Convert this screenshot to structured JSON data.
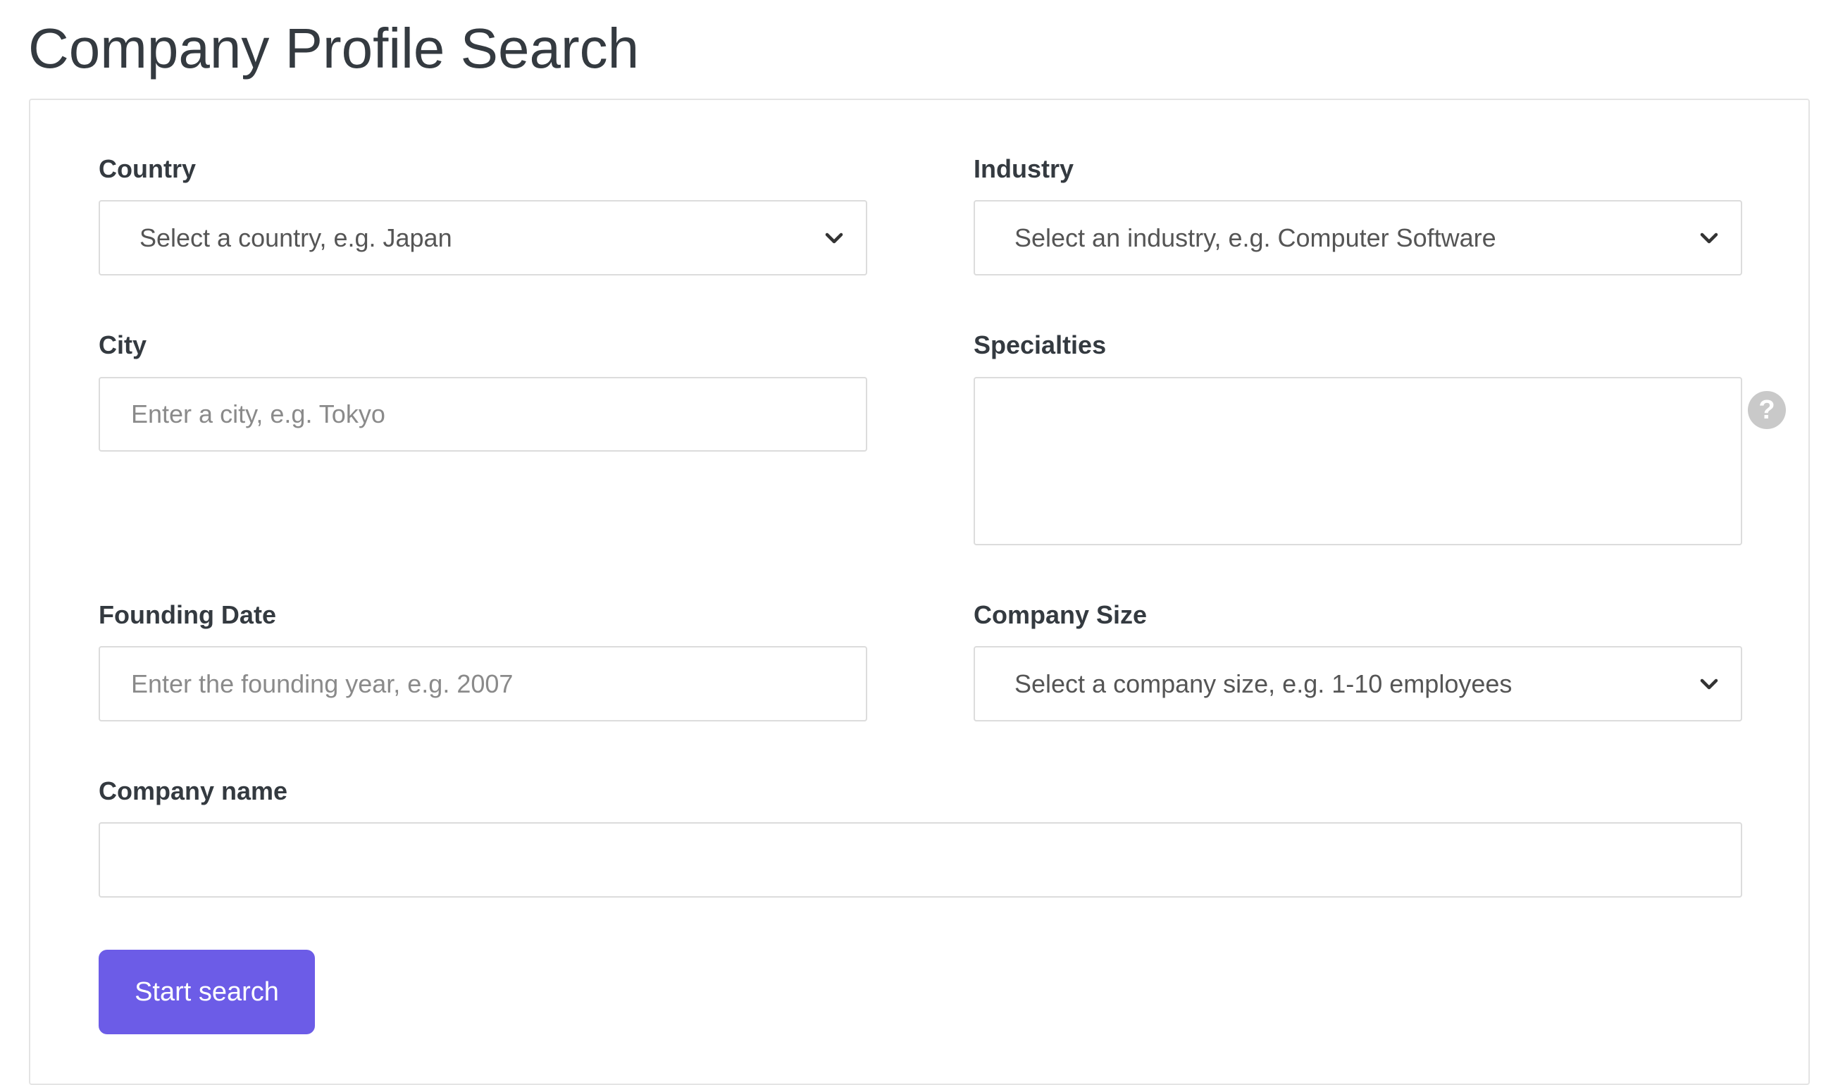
{
  "page": {
    "title": "Company Profile Search"
  },
  "form": {
    "country": {
      "label": "Country",
      "selected": "Select a country, e.g. Japan"
    },
    "industry": {
      "label": "Industry",
      "selected": "Select an industry, e.g. Computer Software"
    },
    "city": {
      "label": "City",
      "value": "",
      "placeholder": "Enter a city, e.g. Tokyo"
    },
    "specialties": {
      "label": "Specialties",
      "value": "",
      "help_icon": "question-circle-icon",
      "help_glyph": "?"
    },
    "founding_date": {
      "label": "Founding Date",
      "value": "",
      "placeholder": "Enter the founding year, e.g. 2007"
    },
    "company_size": {
      "label": "Company Size",
      "selected": "Select a company size, e.g. 1-10 employees"
    },
    "company_name": {
      "label": "Company name",
      "value": "",
      "placeholder": ""
    },
    "submit_label": "Start search"
  },
  "colors": {
    "primary": "#6c5ce7",
    "help_icon": "#c9c9c9",
    "border": "#dcdcdc",
    "text": "#343a40"
  }
}
